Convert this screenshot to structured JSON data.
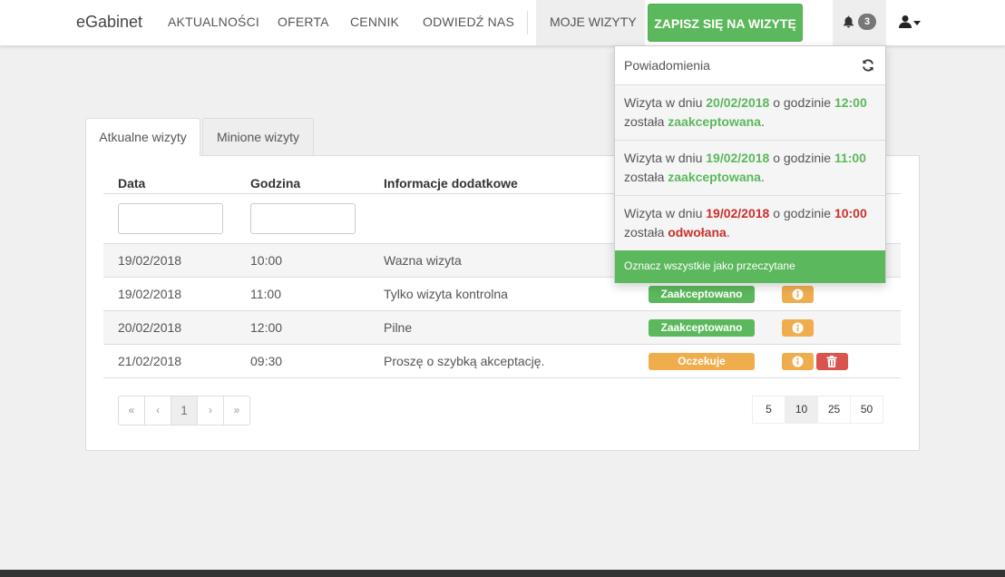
{
  "nav": {
    "brand": "eGabinet",
    "links": [
      "AKTUALNOŚCI",
      "OFERTA",
      "CENNIK",
      "ODWIEDŹ NAS"
    ],
    "active_link": "MOJE WIZYTY",
    "cta": "ZAPISZ SIĘ NA WIZYTĘ",
    "notification_count": "3"
  },
  "tabs": {
    "current": "Atkualne wizyty",
    "past": "Minione wizyty"
  },
  "table": {
    "headers": {
      "date": "Data",
      "time": "Godzina",
      "info": "Informacje dodatkowe"
    },
    "rows": [
      {
        "date": "19/02/2018",
        "time": "10:00",
        "info": "Wazna wizyta",
        "status": ""
      },
      {
        "date": "19/02/2018",
        "time": "11:00",
        "info": "Tylko wizyta kontrolna",
        "status": "Zaakceptowano"
      },
      {
        "date": "20/02/2018",
        "time": "12:00",
        "info": "Pilne",
        "status": "Zaakceptowano"
      },
      {
        "date": "21/02/2018",
        "time": "09:30",
        "info": "Proszę o szybką akceptację.",
        "status": "Oczekuje"
      }
    ]
  },
  "pagination": {
    "first": "«",
    "prev": "‹",
    "current": "1",
    "next": "›",
    "last": "»",
    "page_sizes": [
      "5",
      "10",
      "25",
      "50"
    ],
    "active_page_size": "10"
  },
  "notifications": {
    "title": "Powiadomienia",
    "items": [
      {
        "prefix": "Wizyta w dniu ",
        "date": "20/02/2018",
        "mid": " o godzinie ",
        "time": "12:00",
        "l2_prefix": "została ",
        "status": "zaakceptowana",
        "suffix": "."
      },
      {
        "prefix": "Wizyta w dniu ",
        "date": "19/02/2018",
        "mid": " o godzinie ",
        "time": "11:00",
        "l2_prefix": "została ",
        "status": "zaakceptowana",
        "suffix": "."
      },
      {
        "prefix": "Wizyta w dniu ",
        "date": "19/02/2018",
        "mid": " o godzinie ",
        "time": "10:00",
        "l2_prefix": "została ",
        "status": "odwołana",
        "suffix": "."
      }
    ],
    "mark_all": "Oznacz wszystkie jako przeczytane"
  },
  "colors": {
    "success": "#5cb85c",
    "warning": "#f0ad4e",
    "danger": "#d9534f"
  },
  "icons": [
    "bell-icon",
    "user-icon",
    "caret-down-icon",
    "refresh-icon",
    "info-icon",
    "trash-icon"
  ]
}
